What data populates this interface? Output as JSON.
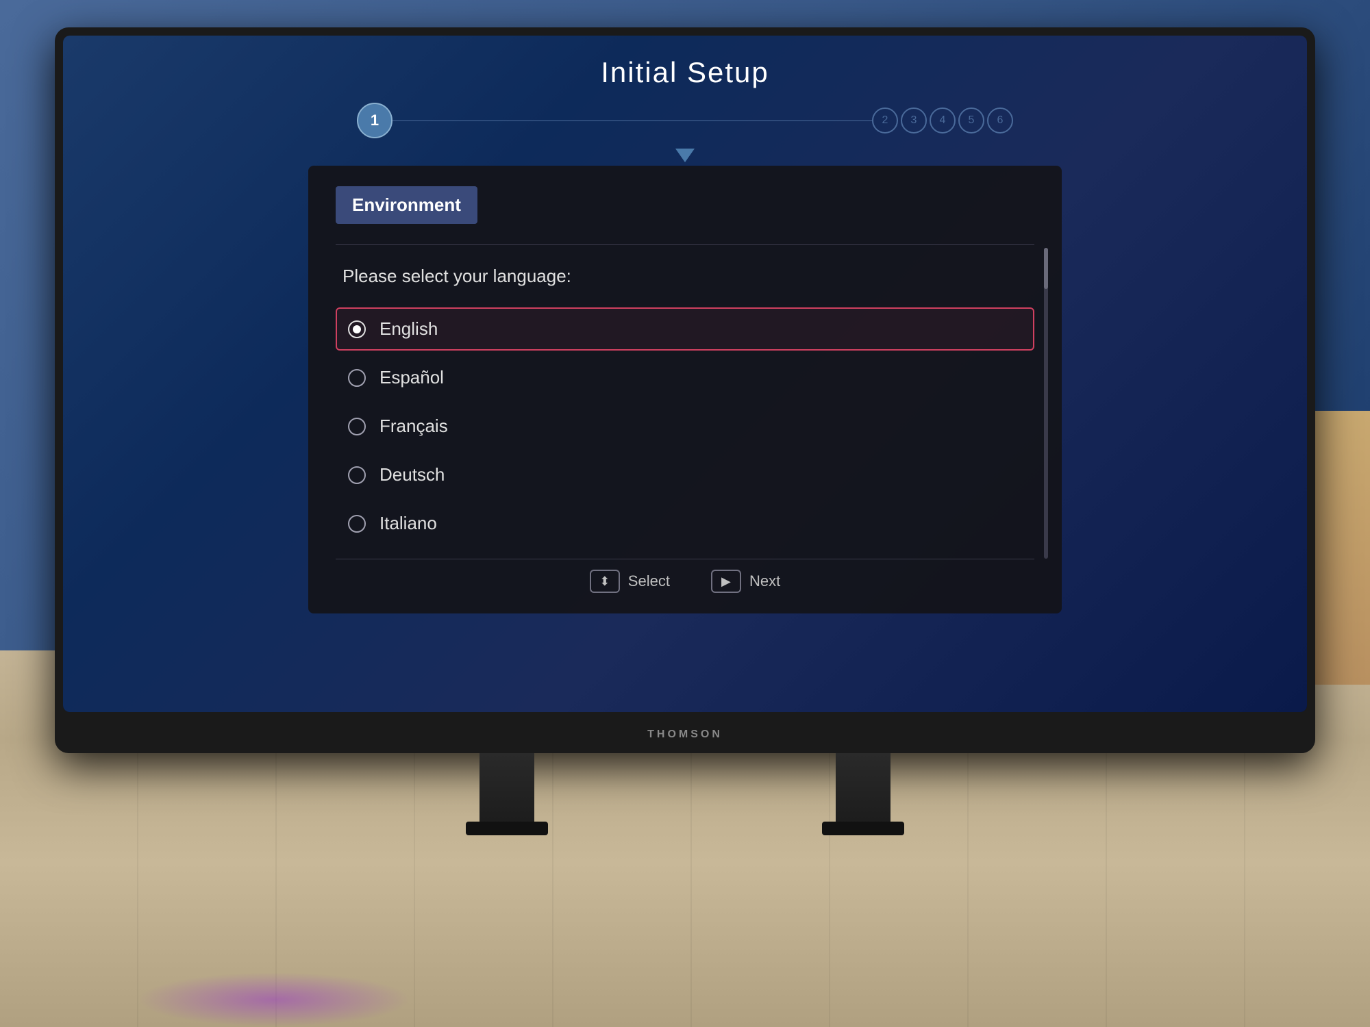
{
  "screen": {
    "title": "Initial Setup",
    "brand": "THOMSON"
  },
  "steps": {
    "active": "1",
    "inactive": [
      "2",
      "3",
      "4",
      "5",
      "6"
    ]
  },
  "section": {
    "title": "Environment"
  },
  "language_prompt": "Please select your language:",
  "languages": [
    {
      "id": "english",
      "label": "English",
      "selected": true
    },
    {
      "id": "espanol",
      "label": "Español",
      "selected": false
    },
    {
      "id": "francais",
      "label": "Français",
      "selected": false
    },
    {
      "id": "deutsch",
      "label": "Deutsch",
      "selected": false
    },
    {
      "id": "italiano",
      "label": "Italiano",
      "selected": false
    }
  ],
  "controls": {
    "select_icon": "⬍",
    "select_label": "Select",
    "next_icon": "▶",
    "next_label": "Next"
  }
}
